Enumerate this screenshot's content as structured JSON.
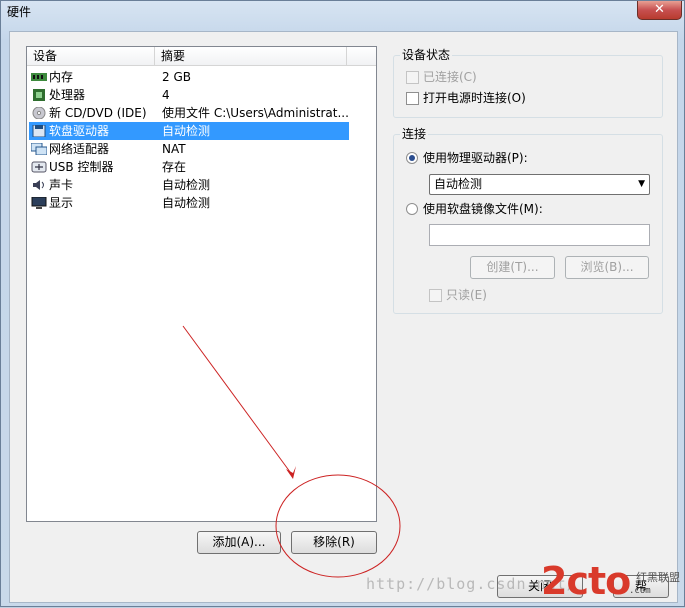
{
  "window": {
    "title": "硬件",
    "close_glyph": "✕"
  },
  "device_list": {
    "columns": [
      "设备",
      "摘要"
    ],
    "rows": [
      {
        "name": "内存",
        "summary": "2 GB",
        "icon": "memory-icon"
      },
      {
        "name": "处理器",
        "summary": "4",
        "icon": "processor-icon"
      },
      {
        "name": "新 CD/DVD (IDE)",
        "summary": "使用文件 C:\\Users\\Administrat...",
        "icon": "cd-dvd-icon"
      },
      {
        "name": "软盘驱动器",
        "summary": "自动检测",
        "icon": "floppy-icon",
        "selected": true
      },
      {
        "name": "网络适配器",
        "summary": "NAT",
        "icon": "network-adapter-icon"
      },
      {
        "name": "USB 控制器",
        "summary": "存在",
        "icon": "usb-icon"
      },
      {
        "name": "声卡",
        "summary": "自动检测",
        "icon": "sound-card-icon"
      },
      {
        "name": "显示",
        "summary": "自动检测",
        "icon": "display-icon"
      }
    ]
  },
  "buttons": {
    "add": "添加(A)...",
    "remove": "移除(R)",
    "close": "关闭",
    "help": "帮"
  },
  "device_status": {
    "title": "设备状态",
    "connected": "已连接(C)",
    "connect_on_power": "打开电源时连接(O)"
  },
  "connection": {
    "title": "连接",
    "use_physical": "使用物理驱动器(P):",
    "physical_value": "自动检测",
    "use_image": "使用软盘镜像文件(M):",
    "create": "创建(T)...",
    "browse": "浏览(B)...",
    "read_only": "只读(E)"
  },
  "watermark": {
    "url": "http://blog.csdn.net/",
    "logo": "2cto",
    "logo_sub": "红黑联盟",
    "logo_url": ".com"
  },
  "colors": {
    "selection": "#3399ff",
    "annotation": "#cc2222"
  }
}
